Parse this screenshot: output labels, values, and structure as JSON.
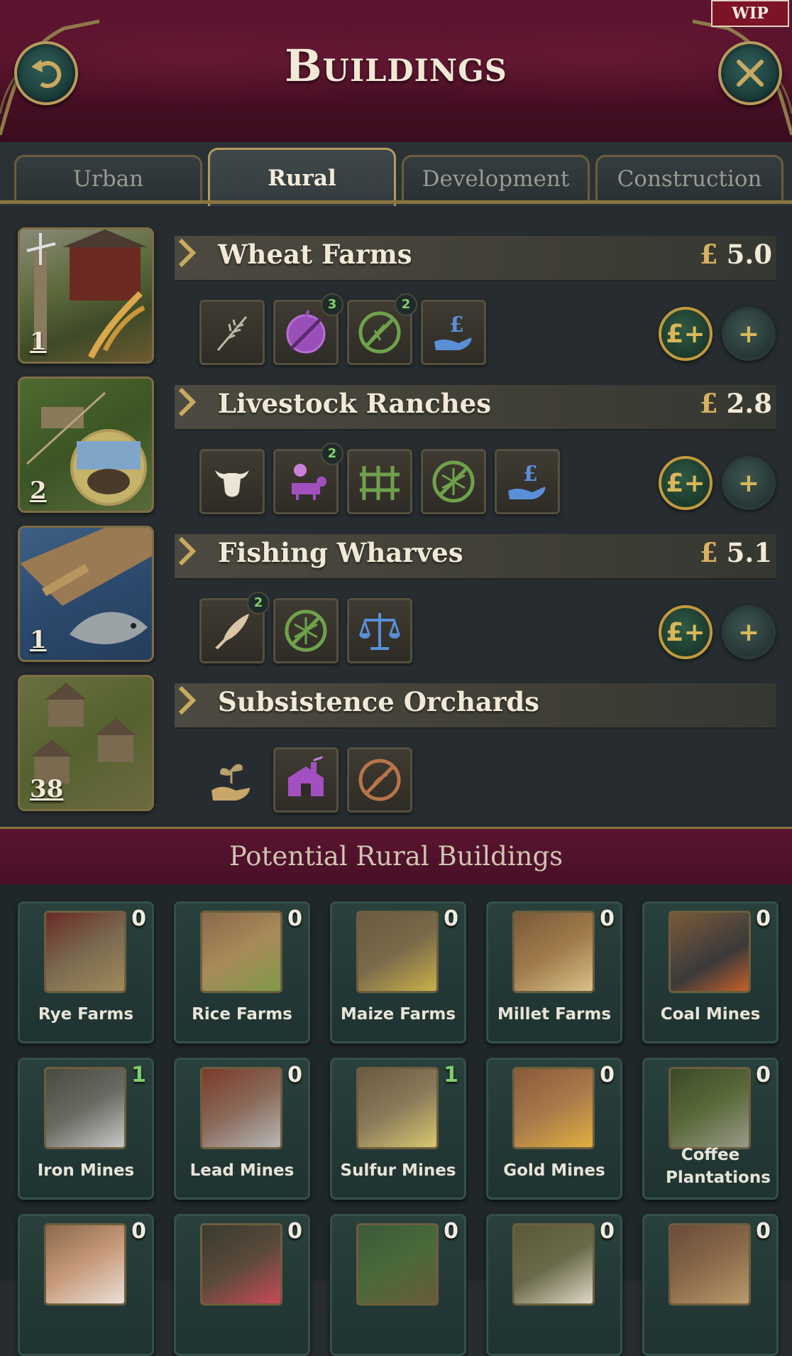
{
  "header": {
    "title": "Buildings",
    "wip_label": "WIP"
  },
  "tabs": [
    {
      "label": "Urban"
    },
    {
      "label": "Rural",
      "active": true
    },
    {
      "label": "Development"
    },
    {
      "label": "Construction"
    }
  ],
  "buildings": [
    {
      "name": "Wheat Farms",
      "price": "5.0",
      "currency": "£",
      "count": "1",
      "icons": [
        "wheat-icon",
        "fertilizer-icon",
        "no-weeds-icon",
        "subsidy-icon"
      ],
      "badges": [
        "",
        "3",
        "2",
        ""
      ]
    },
    {
      "name": "Livestock Ranches",
      "price": "2.8",
      "currency": "£",
      "count": "2",
      "icons": [
        "cow-head-icon",
        "sheep-icon",
        "fence-icon",
        "no-frost-icon",
        "subsidy-icon"
      ],
      "badges": [
        "",
        "2",
        "",
        "",
        ""
      ]
    },
    {
      "name": "Fishing Wharves",
      "price": "5.1",
      "currency": "£",
      "count": "1",
      "icons": [
        "fish-icon",
        "no-frost-icon",
        "scales-icon"
      ],
      "badges": [
        "2",
        "",
        ""
      ]
    },
    {
      "name": "Subsistence Orchards",
      "price": "",
      "currency": "",
      "count": "38",
      "icons": [
        "seedling-hand-icon",
        "factory-house-icon",
        "no-harvest-icon"
      ],
      "badges": [
        "",
        "",
        ""
      ]
    }
  ],
  "actions": {
    "invest_label": "£+",
    "add_label": "+"
  },
  "potential": {
    "title": "Potential Rural Buildings",
    "items": [
      {
        "label": "Rye Farms",
        "count": "0"
      },
      {
        "label": "Rice Farms",
        "count": "0"
      },
      {
        "label": "Maize Farms",
        "count": "0"
      },
      {
        "label": "Millet Farms",
        "count": "0"
      },
      {
        "label": "Coal Mines",
        "count": "0"
      },
      {
        "label": "Iron Mines",
        "count": "1"
      },
      {
        "label": "Lead Mines",
        "count": "0"
      },
      {
        "label": "Sulfur Mines",
        "count": "1"
      },
      {
        "label": "Gold Mines",
        "count": "0"
      },
      {
        "label": "Coffee Plantations",
        "count": "0"
      },
      {
        "label": "",
        "count": "0"
      },
      {
        "label": "",
        "count": "0"
      },
      {
        "label": "",
        "count": "0"
      },
      {
        "label": "",
        "count": "0"
      },
      {
        "label": "",
        "count": "0"
      }
    ]
  },
  "colors": {
    "accent_gold": "#c09a3e",
    "header_maroon": "#4b0f26",
    "badge_green": "#7fd06a"
  }
}
